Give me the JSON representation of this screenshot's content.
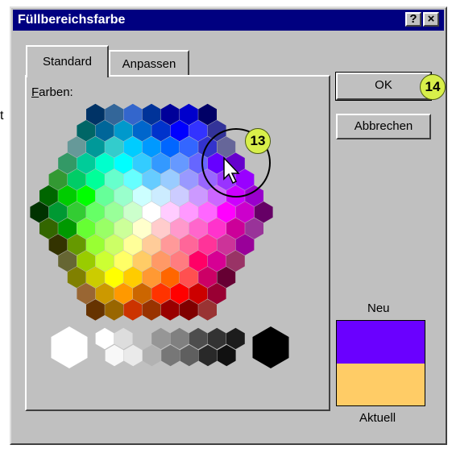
{
  "bleed_text": "t",
  "window": {
    "title": "Füllbereichsfarbe",
    "help_label": "?",
    "close_label": "×"
  },
  "tabs": [
    {
      "label": "Standard",
      "active": true
    },
    {
      "label": "Anpassen",
      "active": false
    }
  ],
  "panel": {
    "colors_label_accel": "F",
    "colors_label_rest": "arben:"
  },
  "buttons": {
    "ok": "OK",
    "cancel": "Abbrechen"
  },
  "preview": {
    "new_label": "Neu",
    "current_label": "Aktuell",
    "new_color": "#6a00ff",
    "current_color": "#ffcc66"
  },
  "annotations": {
    "badge_ok": "14",
    "badge_selected": "13"
  },
  "palette": {
    "selected_color": "#3535c4",
    "hex_rows": [
      [
        "#003366",
        "#336699",
        "#3366cc",
        "#003399",
        "#000099",
        "#0000cc",
        "#000066"
      ],
      [
        "#006666",
        "#006699",
        "#0099cc",
        "#0066cc",
        "#0033cc",
        "#0000ff",
        "#3333ff",
        "#333399"
      ],
      [
        "#669999",
        "#009999",
        "#33cccc",
        "#00ccff",
        "#0099ff",
        "#0066ff",
        "#3366ff",
        "#3333cc",
        "#666699"
      ],
      [
        "#339966",
        "#00cc99",
        "#00ffcc",
        "#00ffff",
        "#33ccff",
        "#3399ff",
        "#6699ff",
        "#6666ff",
        "#6600ff",
        "#6600cc"
      ],
      [
        "#339933",
        "#00cc66",
        "#00ff99",
        "#66ffcc",
        "#66ffff",
        "#66ccff",
        "#99ccff",
        "#9999ff",
        "#9966ff",
        "#9933ff",
        "#9900ff"
      ],
      [
        "#006600",
        "#00cc00",
        "#00ff00",
        "#66ff99",
        "#99ffcc",
        "#ccffff",
        "#ccecff",
        "#ccccff",
        "#cc99ff",
        "#cc66ff",
        "#cc00ff",
        "#9900cc"
      ],
      [
        "#003300",
        "#009933",
        "#33cc33",
        "#66ff66",
        "#99ff99",
        "#ccffcc",
        "#ffffff",
        "#ffccff",
        "#ff99ff",
        "#ff66ff",
        "#ff00ff",
        "#cc00cc",
        "#660066"
      ],
      [
        "#336600",
        "#009900",
        "#66ff33",
        "#99ff66",
        "#ccff99",
        "#ffffcc",
        "#ffcccc",
        "#ff99cc",
        "#ff66cc",
        "#ff33cc",
        "#cc0099",
        "#993399"
      ],
      [
        "#333300",
        "#669900",
        "#99ff33",
        "#ccff66",
        "#ffff99",
        "#ffcc99",
        "#ff9999",
        "#ff6699",
        "#ff3399",
        "#cc3399",
        "#990099"
      ],
      [
        "#666633",
        "#99cc00",
        "#ccff33",
        "#ffff66",
        "#ffcc66",
        "#ff9966",
        "#ff7c80",
        "#ff0066",
        "#d60093",
        "#993366"
      ],
      [
        "#808000",
        "#cccc00",
        "#ffff00",
        "#ffcc00",
        "#ff9933",
        "#ff6600",
        "#ff5050",
        "#cc0066",
        "#660033"
      ],
      [
        "#996633",
        "#cc9900",
        "#ff9900",
        "#cc6600",
        "#ff3300",
        "#ff0000",
        "#cc0000",
        "#990033"
      ],
      [
        "#663300",
        "#996600",
        "#cc3300",
        "#993300",
        "#990000",
        "#800000",
        "#993333"
      ]
    ],
    "big_white": "#ffffff",
    "big_black": "#000000",
    "gray_top": [
      "#ffffff",
      "#dddddd",
      "#c0c0c0",
      "#969696",
      "#808080",
      "#4d4d4d",
      "#333333",
      "#1c1c1c"
    ],
    "gray_bottom": [
      "#f8f8f8",
      "#eaeaea",
      "#b2b2b2",
      "#777777",
      "#5f5f5f",
      "#292929",
      "#111111"
    ]
  }
}
